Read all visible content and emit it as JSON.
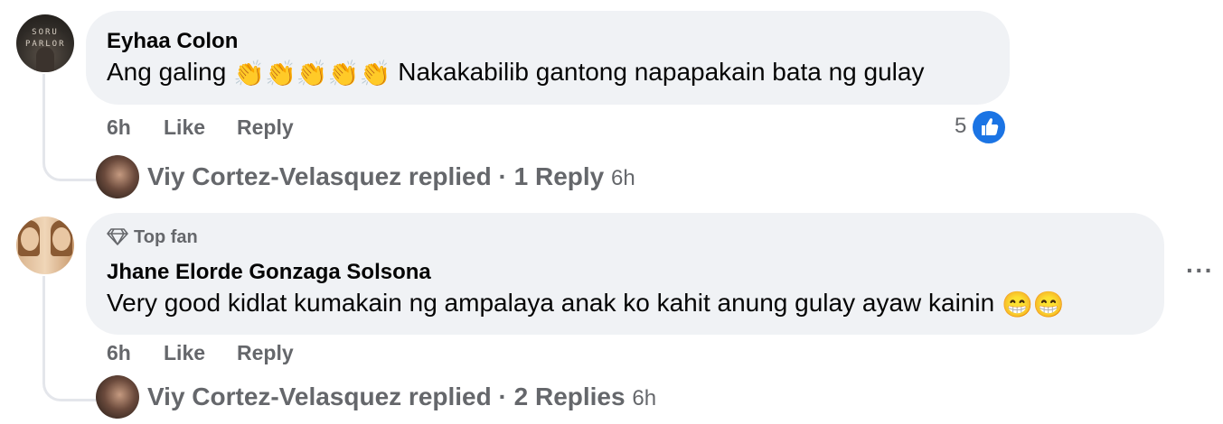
{
  "comments": [
    {
      "author": "Eyhaa Colon",
      "avatar_sign": "SORU\nPARLOR",
      "text_prefix": "Ang galing ",
      "emojis": "👏👏👏👏👏",
      "text_suffix": " Nakakabilib gantong napapakain bata ng gulay",
      "time": "6h",
      "like_label": "Like",
      "reply_label": "Reply",
      "reaction_count": "5",
      "reply_summary": {
        "name": "Viy Cortez-Velasquez replied",
        "separator": "·",
        "count": "1 Reply",
        "time": "6h"
      }
    },
    {
      "badge": "Top fan",
      "author": "Jhane Elorde Gonzaga Solsona",
      "text": "Very good kidlat kumakain ng ampalaya anak ko kahit anung gulay ayaw kainin ",
      "emojis": "😁😁",
      "time": "6h",
      "like_label": "Like",
      "reply_label": "Reply",
      "more_label": "···",
      "reply_summary": {
        "name": "Viy Cortez-Velasquez replied",
        "separator": "·",
        "count": "2 Replies",
        "time": "6h"
      }
    }
  ],
  "colors": {
    "bubble": "#f0f2f5",
    "secondary_text": "#65676b",
    "like_blue": "#1b74e4"
  }
}
